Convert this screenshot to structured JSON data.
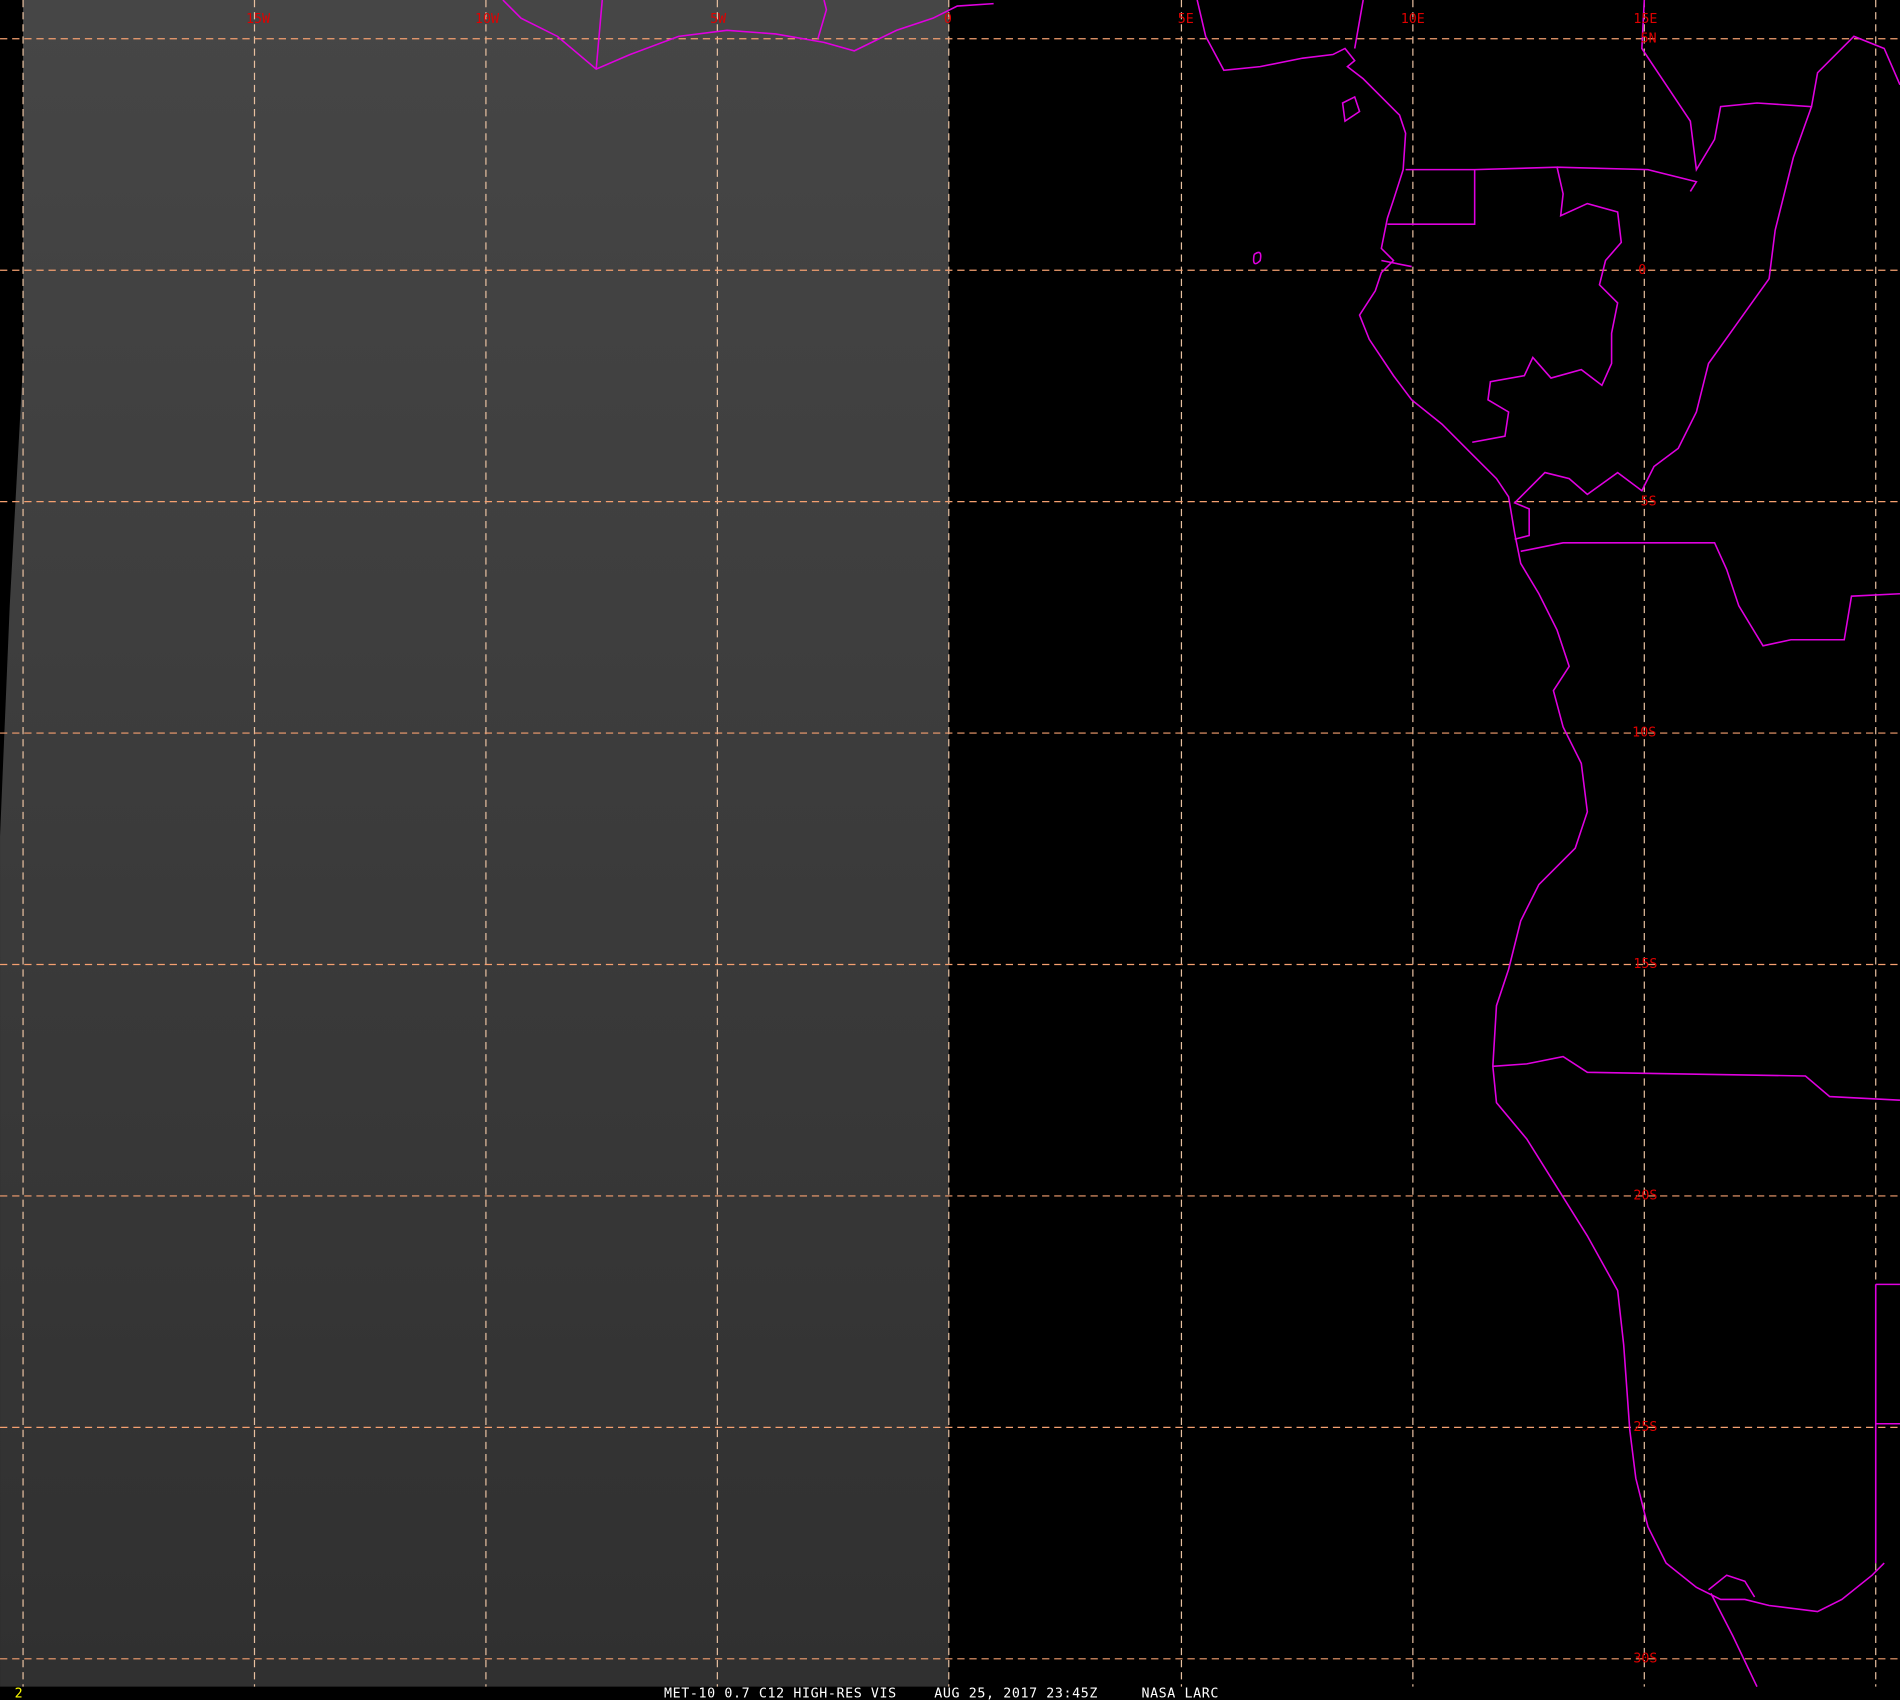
{
  "map": {
    "longitude_labels": [
      "15W",
      "10W",
      "5W",
      "0",
      "5E",
      "10E",
      "15E"
    ],
    "latitude_labels": [
      "5N",
      "0",
      "5S",
      "10S",
      "15S",
      "20S",
      "25S",
      "30S"
    ],
    "colors": {
      "grid": "#f5a070",
      "coastline": "#e000e0",
      "labels": "#e00000",
      "image_gray": "#3c3c3c"
    }
  },
  "footer": {
    "frame_number": "2",
    "product": "MET-10 0.7 C12 HIGH-RES VIS",
    "datetime": "AUG 25, 2017 23:45Z",
    "source": "NASA LARC"
  }
}
